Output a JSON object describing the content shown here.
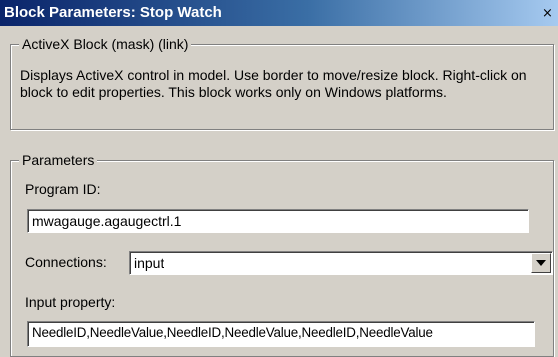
{
  "window": {
    "title": "Block Parameters: Stop Watch",
    "close_glyph": "×"
  },
  "block": {
    "group_label": "ActiveX Block (mask) (link)",
    "description": "Displays ActiveX control in model. Use border to move/resize block. Right-click on block to edit properties. This block works only on Windows platforms."
  },
  "parameters": {
    "group_label": "Parameters",
    "program_id_label": "Program ID:",
    "program_id_value": "mwagauge.agaugectrl.1",
    "connections_label": "Connections:",
    "connections_value": "input",
    "connections_icon": "chevron-down-icon",
    "input_property_label": "Input property:",
    "input_property_value": "NeedleID,NeedleValue,NeedleID,NeedleValue,NeedleID,NeedleValue"
  }
}
